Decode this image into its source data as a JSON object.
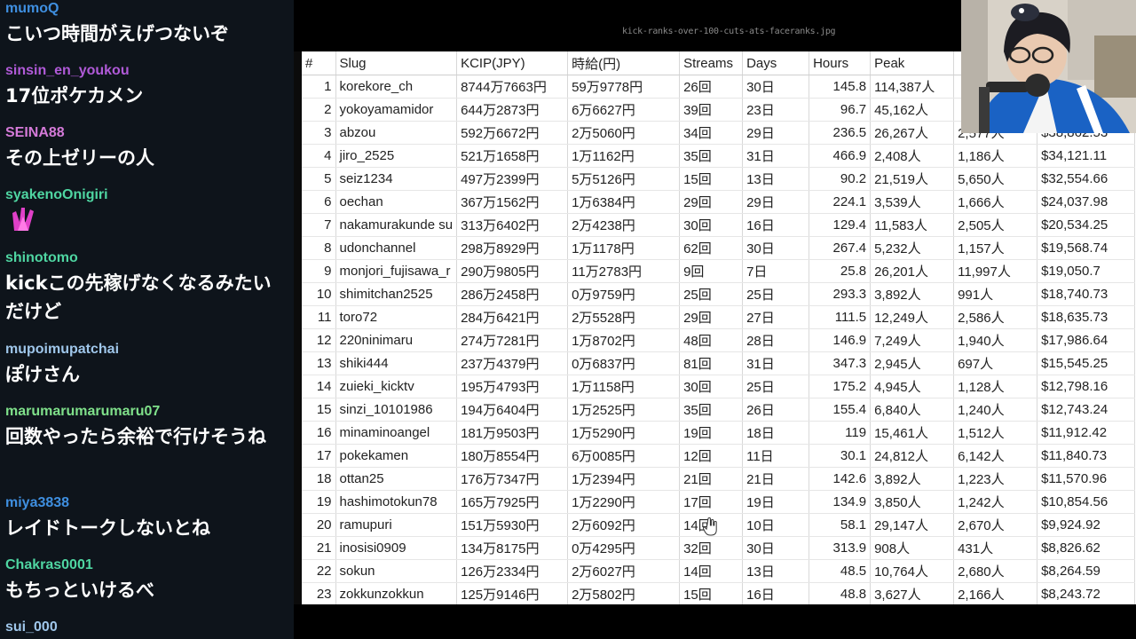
{
  "chat": {
    "messages": [
      {
        "user": "mumoQ",
        "color": "#3f8fe0",
        "text": "こいつ時間がえげつないぞ"
      },
      {
        "user": "sinsin_en_youkou",
        "color": "#b05ad8",
        "text": "17位ポケカメン"
      },
      {
        "user": "SEINA88",
        "color": "#d47ad8",
        "text": "その上ゼリーの人"
      },
      {
        "user": "syakenoOnigiri",
        "color": "#4fd6a2",
        "emote": "pink-hands-emote"
      },
      {
        "user": "shinotomo",
        "color": "#4fd6a2",
        "text": "kickこの先稼げなくなるみたいだけど"
      },
      {
        "user": "mupoimupatchai",
        "color": "#9fc6ea",
        "text": "ぽけさん"
      },
      {
        "user": "marumarumarumaru07",
        "color": "#7fe08a",
        "text": "回数やったら余裕で行けそうね"
      },
      {
        "user": "miya3838",
        "color": "#3f8fe0",
        "text": "レイドトークしないとね"
      },
      {
        "user": "Chakras0001",
        "color": "#4fd6a2",
        "text": "もちっといけるべ"
      },
      {
        "user": "sui_000",
        "color": "#9fc6ea",
        "text": ""
      }
    ]
  },
  "stream": {
    "filename": "kick-ranks-over-100-cuts-ats-faceranks.jpg",
    "table": {
      "headers": [
        "#",
        "Slug",
        "KCIP(JPY)",
        "時給(円)",
        "Streams",
        "Days",
        "Hours",
        "Peak",
        "",
        ""
      ],
      "rows": [
        [
          "1",
          "korekore_ch",
          "8744万7663円",
          "59万9778円",
          "26回",
          "30日",
          "145.8",
          "114,387人",
          "",
          ""
        ],
        [
          "2",
          "yokoyamamidor",
          "644万2873円",
          "6万6627円",
          "39回",
          "23日",
          "96.7",
          "45,162人",
          "",
          ""
        ],
        [
          "3",
          "abzou",
          "592万6672円",
          "2万5060円",
          "34回",
          "29日",
          "236.5",
          "26,267人",
          "2,577人",
          "$38,862.53"
        ],
        [
          "4",
          "jiro_2525",
          "521万1658円",
          "1万1162円",
          "35回",
          "31日",
          "466.9",
          "2,408人",
          "1,186人",
          "$34,121.11"
        ],
        [
          "5",
          "seiz1234",
          "497万2399円",
          "5万5126円",
          "15回",
          "13日",
          "90.2",
          "21,519人",
          "5,650人",
          "$32,554.66"
        ],
        [
          "6",
          "oechan",
          "367万1562円",
          "1万6384円",
          "29回",
          "29日",
          "224.1",
          "3,539人",
          "1,666人",
          "$24,037.98"
        ],
        [
          "7",
          "nakamurakunde su",
          "313万6402円",
          "2万4238円",
          "30回",
          "16日",
          "129.4",
          "11,583人",
          "2,505人",
          "$20,534.25"
        ],
        [
          "8",
          "udonchannel",
          "298万8929円",
          "1万1178円",
          "62回",
          "30日",
          "267.4",
          "5,232人",
          "1,157人",
          "$19,568.74"
        ],
        [
          "9",
          "monjori_fujisawa_r",
          "290万9805円",
          "11万2783円",
          "9回",
          "7日",
          "25.8",
          "26,201人",
          "11,997人",
          "$19,050.7"
        ],
        [
          "10",
          "shimitchan2525",
          "286万2458円",
          "0万9759円",
          "25回",
          "25日",
          "293.3",
          "3,892人",
          "991人",
          "$18,740.73"
        ],
        [
          "11",
          "toro72",
          "284万6421円",
          "2万5528円",
          "29回",
          "27日",
          "111.5",
          "12,249人",
          "2,586人",
          "$18,635.73"
        ],
        [
          "12",
          "220ninimaru",
          "274万7281円",
          "1万8702円",
          "48回",
          "28日",
          "146.9",
          "7,249人",
          "1,940人",
          "$17,986.64"
        ],
        [
          "13",
          "shiki444",
          "237万4379円",
          "0万6837円",
          "81回",
          "31日",
          "347.3",
          "2,945人",
          "697人",
          "$15,545.25"
        ],
        [
          "14",
          "zuieki_kicktv",
          "195万4793円",
          "1万1158円",
          "30回",
          "25日",
          "175.2",
          "4,945人",
          "1,128人",
          "$12,798.16"
        ],
        [
          "15",
          "sinzi_10101986",
          "194万6404円",
          "1万2525円",
          "35回",
          "26日",
          "155.4",
          "6,840人",
          "1,240人",
          "$12,743.24"
        ],
        [
          "16",
          "minaminoangel",
          "181万9503円",
          "1万5290円",
          "19回",
          "18日",
          "119",
          "15,461人",
          "1,512人",
          "$11,912.42"
        ],
        [
          "17",
          "pokekamen",
          "180万8554円",
          "6万0085円",
          "12回",
          "11日",
          "30.1",
          "24,812人",
          "6,142人",
          "$11,840.73"
        ],
        [
          "18",
          "ottan25",
          "176万7347円",
          "1万2394円",
          "21回",
          "21日",
          "142.6",
          "3,892人",
          "1,223人",
          "$11,570.96"
        ],
        [
          "19",
          "hashimotokun78",
          "165万7925円",
          "1万2290円",
          "17回",
          "19日",
          "134.9",
          "3,850人",
          "1,242人",
          "$10,854.56"
        ],
        [
          "20",
          "ramupuri",
          "151万5930円",
          "2万6092円",
          "14回",
          "10日",
          "58.1",
          "29,147人",
          "2,670人",
          "$9,924.92"
        ],
        [
          "21",
          "inosisi0909",
          "134万8175円",
          "0万4295円",
          "32回",
          "30日",
          "313.9",
          "908人",
          "431人",
          "$8,826.62"
        ],
        [
          "22",
          "sokun",
          "126万2334円",
          "2万6027円",
          "14回",
          "13日",
          "48.5",
          "10,764人",
          "2,680人",
          "$8,264.59"
        ],
        [
          "23",
          "zokkunzokkun",
          "125万9146円",
          "2万5802円",
          "15回",
          "16日",
          "48.8",
          "3,627人",
          "2,166人",
          "$8,243.72"
        ]
      ]
    }
  },
  "colors": {
    "chat_bg": "#0e141b",
    "sheet_bg": "#ffffff",
    "grid": "#d8d8d8"
  }
}
